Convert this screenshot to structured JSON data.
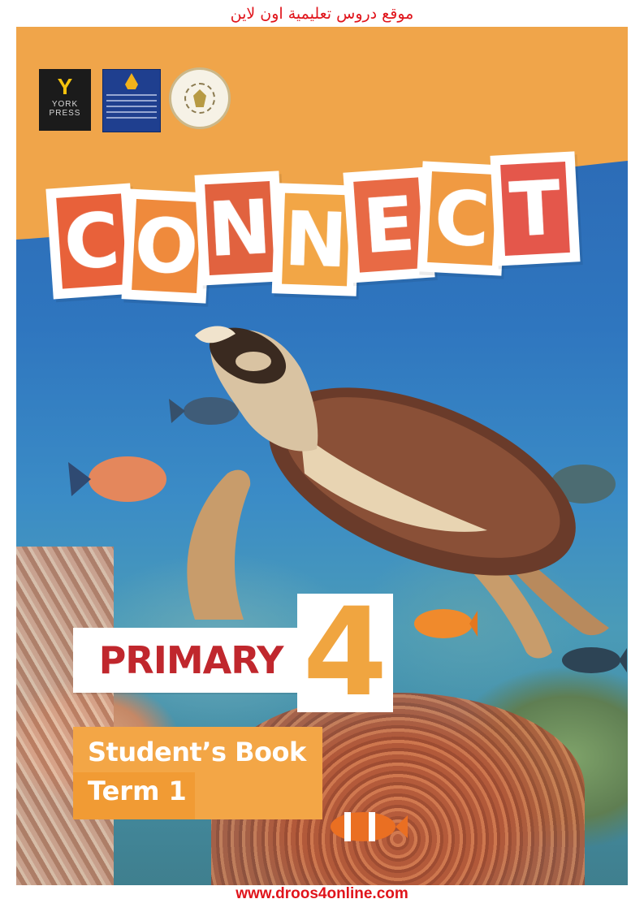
{
  "site": {
    "title": "موقع دروس تعليمية اون لاين",
    "url": "www.droos4online.com",
    "accent_color": "#e0141b"
  },
  "cover": {
    "logos": {
      "york": {
        "mark": "Y",
        "line1": "YORK",
        "line2": "PRESS",
        "icon": "york-press-logo"
      },
      "longman": {
        "icon": "egyptian-international-publishing-longman-logo"
      },
      "ministry": {
        "icon": "ministry-of-education-seal"
      }
    },
    "title_letters": [
      {
        "char": "C",
        "color": "#e8613a"
      },
      {
        "char": "O",
        "color": "#ef8a3c"
      },
      {
        "char": "N",
        "color": "#e1623f"
      },
      {
        "char": "N",
        "color": "#f2a646"
      },
      {
        "char": "E",
        "color": "#e86a45"
      },
      {
        "char": "C",
        "color": "#f09a42"
      },
      {
        "char": "T",
        "color": "#e4574b"
      }
    ],
    "level_label": "PRIMARY",
    "level_number": "4",
    "book_label": "Student’s Book",
    "term_label": "Term 1",
    "colors": {
      "top_band": "#f0a54a",
      "primary_text": "#c0272d",
      "number": "#f0a540",
      "book_box": "#f3a646"
    }
  }
}
